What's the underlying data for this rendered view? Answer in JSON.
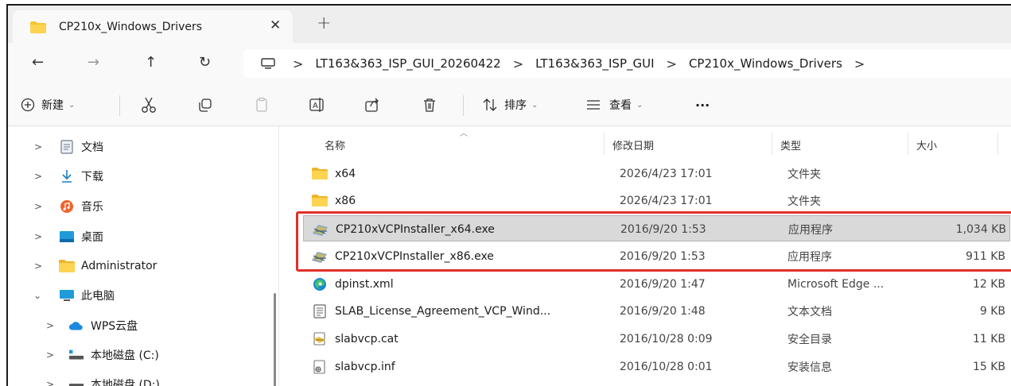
{
  "window": {
    "tab_title": "CP210x_Windows_Drivers",
    "close_tab": "✕",
    "new_tab": "+"
  },
  "nav": {
    "back": "←",
    "forward": "→",
    "up": "↑",
    "refresh": "↻",
    "breadcrumbs": [
      "LT163&363_ISP_GUI_20260422",
      "LT163&363_ISP_GUI",
      "CP210x_Windows_Drivers"
    ],
    "separator": ">"
  },
  "toolbar": {
    "new_label": "新建",
    "sort_label": "排序",
    "view_label": "查看",
    "more_label": "···"
  },
  "sidebar": {
    "items": [
      {
        "label": "文档",
        "icon": "document-icon",
        "expanded": false
      },
      {
        "label": "下载",
        "icon": "download-icon",
        "expanded": false
      },
      {
        "label": "音乐",
        "icon": "music-icon",
        "expanded": false
      },
      {
        "label": "桌面",
        "icon": "desktop-icon",
        "expanded": false
      },
      {
        "label": "Administrator",
        "icon": "folder-icon",
        "expanded": false
      },
      {
        "label": "此电脑",
        "icon": "computer-icon",
        "expanded": true
      },
      {
        "label": "WPS云盘",
        "icon": "cloud-icon",
        "expanded": false
      },
      {
        "label": "本地磁盘 (C:)",
        "icon": "drive-icon",
        "expanded": false
      },
      {
        "label": "本地磁盘 (D:)",
        "icon": "drive-icon",
        "expanded": false
      }
    ]
  },
  "filelist": {
    "columns": {
      "name": "名称",
      "date": "修改日期",
      "type": "类型",
      "size": "大小"
    },
    "files": [
      {
        "name": "x64",
        "date": "2026/4/23 17:01",
        "type": "文件夹",
        "size": "",
        "icon": "folder-icon"
      },
      {
        "name": "x86",
        "date": "2026/4/23 17:01",
        "type": "文件夹",
        "size": "",
        "icon": "folder-icon"
      },
      {
        "name": "CP210xVCPInstaller_x64.exe",
        "date": "2016/9/20 1:53",
        "type": "应用程序",
        "size": "1,034 KB",
        "icon": "installer-icon"
      },
      {
        "name": "CP210xVCPInstaller_x86.exe",
        "date": "2016/9/20 1:53",
        "type": "应用程序",
        "size": "911 KB",
        "icon": "installer-icon"
      },
      {
        "name": "dpinst.xml",
        "date": "2016/9/20 1:47",
        "type": "Microsoft Edge ...",
        "size": "12 KB",
        "icon": "edge-icon"
      },
      {
        "name": "SLAB_License_Agreement_VCP_Wind...",
        "date": "2016/9/20 1:48",
        "type": "文本文档",
        "size": "9 KB",
        "icon": "text-file-icon"
      },
      {
        "name": "slabvcp.cat",
        "date": "2016/10/28 0:09",
        "type": "安全目录",
        "size": "11 KB",
        "icon": "catalog-icon"
      },
      {
        "name": "slabvcp.inf",
        "date": "2016/10/28 0:01",
        "type": "安装信息",
        "size": "15 KB",
        "icon": "inf-icon"
      }
    ]
  },
  "colors": {
    "highlight": "#e0302a",
    "selection": "#cce4f7",
    "folder": "#f7c52f"
  }
}
